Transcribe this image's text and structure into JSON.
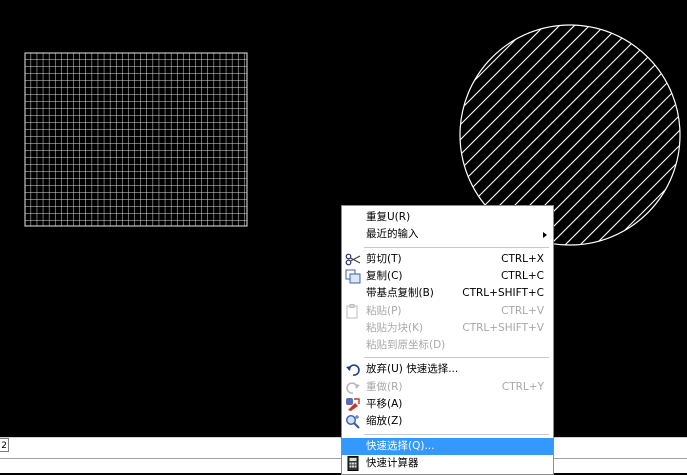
{
  "layout_tab": {
    "label": "2"
  },
  "menu": {
    "groups": [
      [
        {
          "name": "repeat",
          "label": "重复U(R)"
        },
        {
          "name": "recent-input",
          "label": "最近的输入",
          "submenu": true
        }
      ],
      [
        {
          "name": "cut",
          "label": "剪切(T)",
          "shortcut": "CTRL+X",
          "icon": "scissors-icon"
        },
        {
          "name": "copy",
          "label": "复制(C)",
          "shortcut": "CTRL+C",
          "icon": "copy-icon"
        },
        {
          "name": "copy-with-base-point",
          "label": "带基点复制(B)",
          "shortcut": "CTRL+SHIFT+C"
        },
        {
          "name": "paste",
          "label": "粘贴(P)",
          "shortcut": "CTRL+V",
          "icon": "paste-icon",
          "disabled": true
        },
        {
          "name": "paste-as-block",
          "label": "粘贴为块(K)",
          "shortcut": "CTRL+SHIFT+V",
          "disabled": true
        },
        {
          "name": "paste-to-original-coordinates",
          "label": "粘贴到原坐标(D)",
          "disabled": true
        }
      ],
      [
        {
          "name": "undo",
          "label": "放弃(U) 快速选择...",
          "icon": "undo-icon"
        },
        {
          "name": "redo",
          "label": "重做(R)",
          "shortcut": "CTRL+Y",
          "icon": "redo-icon",
          "disabled": true
        },
        {
          "name": "pan",
          "label": "平移(A)",
          "icon": "pan-icon"
        },
        {
          "name": "zoom",
          "label": "缩放(Z)",
          "icon": "zoom-icon"
        }
      ],
      [
        {
          "name": "quick-select",
          "label": "快速选择(Q)...",
          "highlighted": true
        },
        {
          "name": "quickcalc",
          "label": "快速计算器",
          "icon": "calculator-icon"
        }
      ]
    ]
  },
  "colors": {
    "canvas": "#000000",
    "entity": "#ffffff",
    "highlight": "#3399ff",
    "disabled_text": "#a8a8a8"
  }
}
